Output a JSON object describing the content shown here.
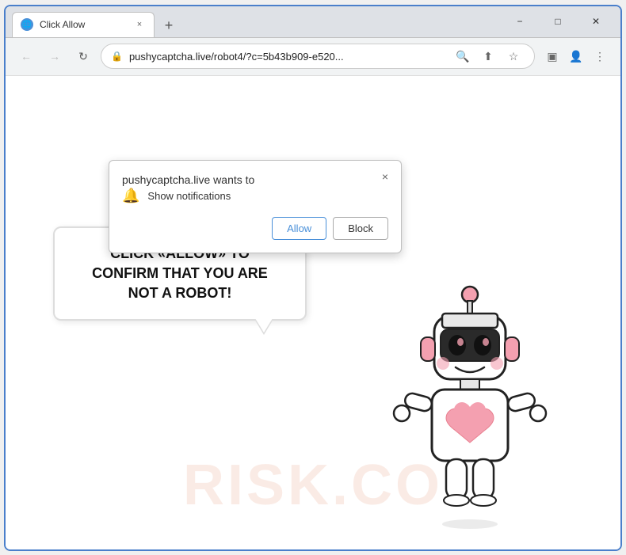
{
  "browser": {
    "tab": {
      "favicon": "🌐",
      "title": "Click Allow",
      "close_label": "×"
    },
    "new_tab_label": "+",
    "window_controls": {
      "minimize": "−",
      "maximize": "□",
      "close": "✕"
    },
    "address_bar": {
      "lock_icon": "🔒",
      "url": "pushycaptcha.live/robot4/?c=5b43b909-e520...",
      "search_icon": "🔍",
      "share_icon": "⬆",
      "bookmark_icon": "☆",
      "split_icon": "▣",
      "profile_icon": "👤",
      "menu_icon": "⋮"
    },
    "nav": {
      "back": "←",
      "forward": "→",
      "refresh": "↻"
    }
  },
  "notification_popup": {
    "title": "pushycaptcha.live wants to",
    "close_label": "×",
    "permission_icon": "🔔",
    "permission_text": "Show notifications",
    "allow_label": "Allow",
    "block_label": "Block"
  },
  "page": {
    "speech_bubble_text": "CLICK «ALLOW» TO CONFIRM THAT YOU ARE NOT A ROBOT!",
    "watermark_text": "RISK.CO"
  },
  "colors": {
    "accent": "#4a90d9",
    "border": "#4a7fcb",
    "watermark": "rgba(220,120,80,0.15)"
  }
}
